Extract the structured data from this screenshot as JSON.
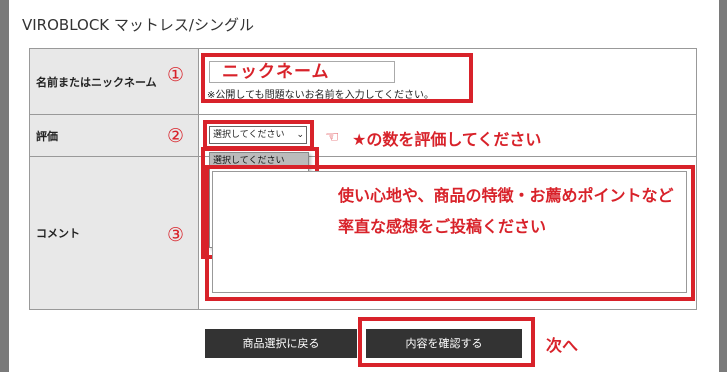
{
  "product_title": "VIROBLOCK マットレス/シングル",
  "form": {
    "nickname_label": "名前またはニックネーム",
    "nickname_value": "ニックネーム",
    "nickname_note": "※公開しても問題ないお名前を入力してください。",
    "rating_label": "評価",
    "rating_select_value": "選択してください",
    "rating_options": [
      "選択してください",
      "★★★★★",
      "★★★★",
      "★★★",
      "★★",
      "★"
    ],
    "comment_label": "コメント"
  },
  "annotations": {
    "step1": "①",
    "step2": "②",
    "step3": "③",
    "rating_hint": "★の数を評価してください",
    "comment_hint": "使い心地や、商品の特徴・お薦めポイントなど率直な感想をご投稿ください",
    "next_label": "次へ"
  },
  "buttons": {
    "back_label": "商品選択に戻る",
    "confirm_label": "内容を確認する"
  },
  "colors": {
    "annotation_red": "#d8222a",
    "button_dark": "#333333",
    "label_bg": "#e8e8e8"
  }
}
